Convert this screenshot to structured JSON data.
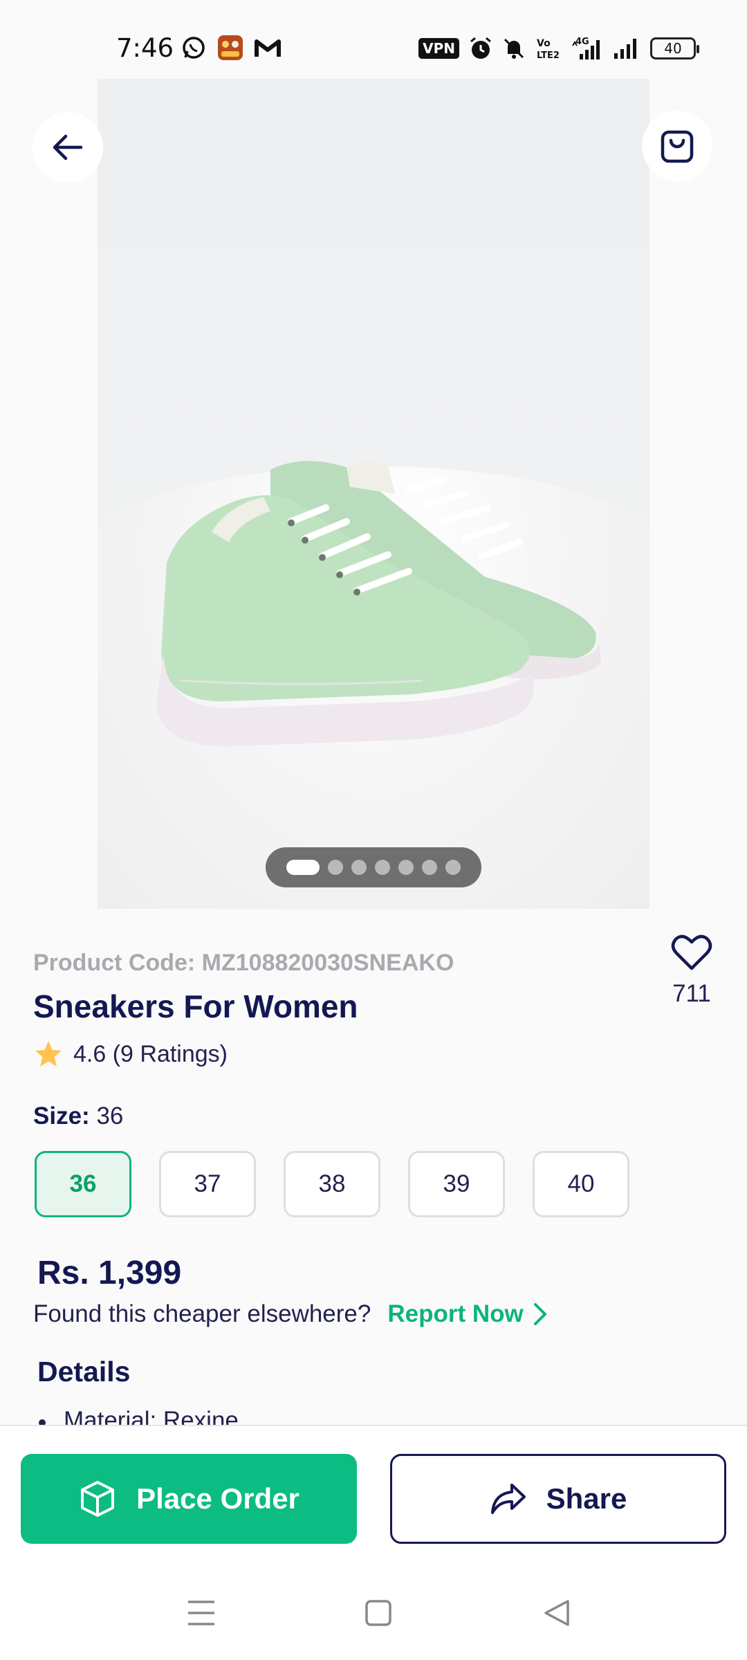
{
  "status_bar": {
    "time": "7:46",
    "vpn_label": "VPN",
    "network_label": "4G",
    "battery_level": "40",
    "left_icons": [
      "whatsapp-icon",
      "game-app-icon",
      "mail-m-icon"
    ],
    "right_icons": [
      "vpn-icon",
      "alarm-icon",
      "mute-icon",
      "volte-icon",
      "signal-4g-icon",
      "signal-icon",
      "battery-icon"
    ]
  },
  "product_image": {
    "carousel_total": 7,
    "carousel_active": 1
  },
  "product": {
    "code": "Product Code: MZ108820030SNEAKO",
    "title": "Sneakers For Women",
    "rating": "4.6 (9 Ratings)",
    "wishlist_count": "711"
  },
  "size": {
    "label": "Size:",
    "selected": "36",
    "options": [
      "36",
      "37",
      "38",
      "39",
      "40"
    ]
  },
  "pricing": {
    "price": "Rs. 1,399",
    "cheaper_text": "Found this cheaper elsewhere?",
    "report_link": "Report Now"
  },
  "details": {
    "title": "Details",
    "items": [
      "Material: Rexine"
    ]
  },
  "actions": {
    "place_order": "Place Order",
    "share": "Share"
  },
  "colors": {
    "accent_green": "#0cbc82",
    "navy": "#141852",
    "star": "#ffc44d",
    "selected_bg": "#e6f6ee"
  }
}
